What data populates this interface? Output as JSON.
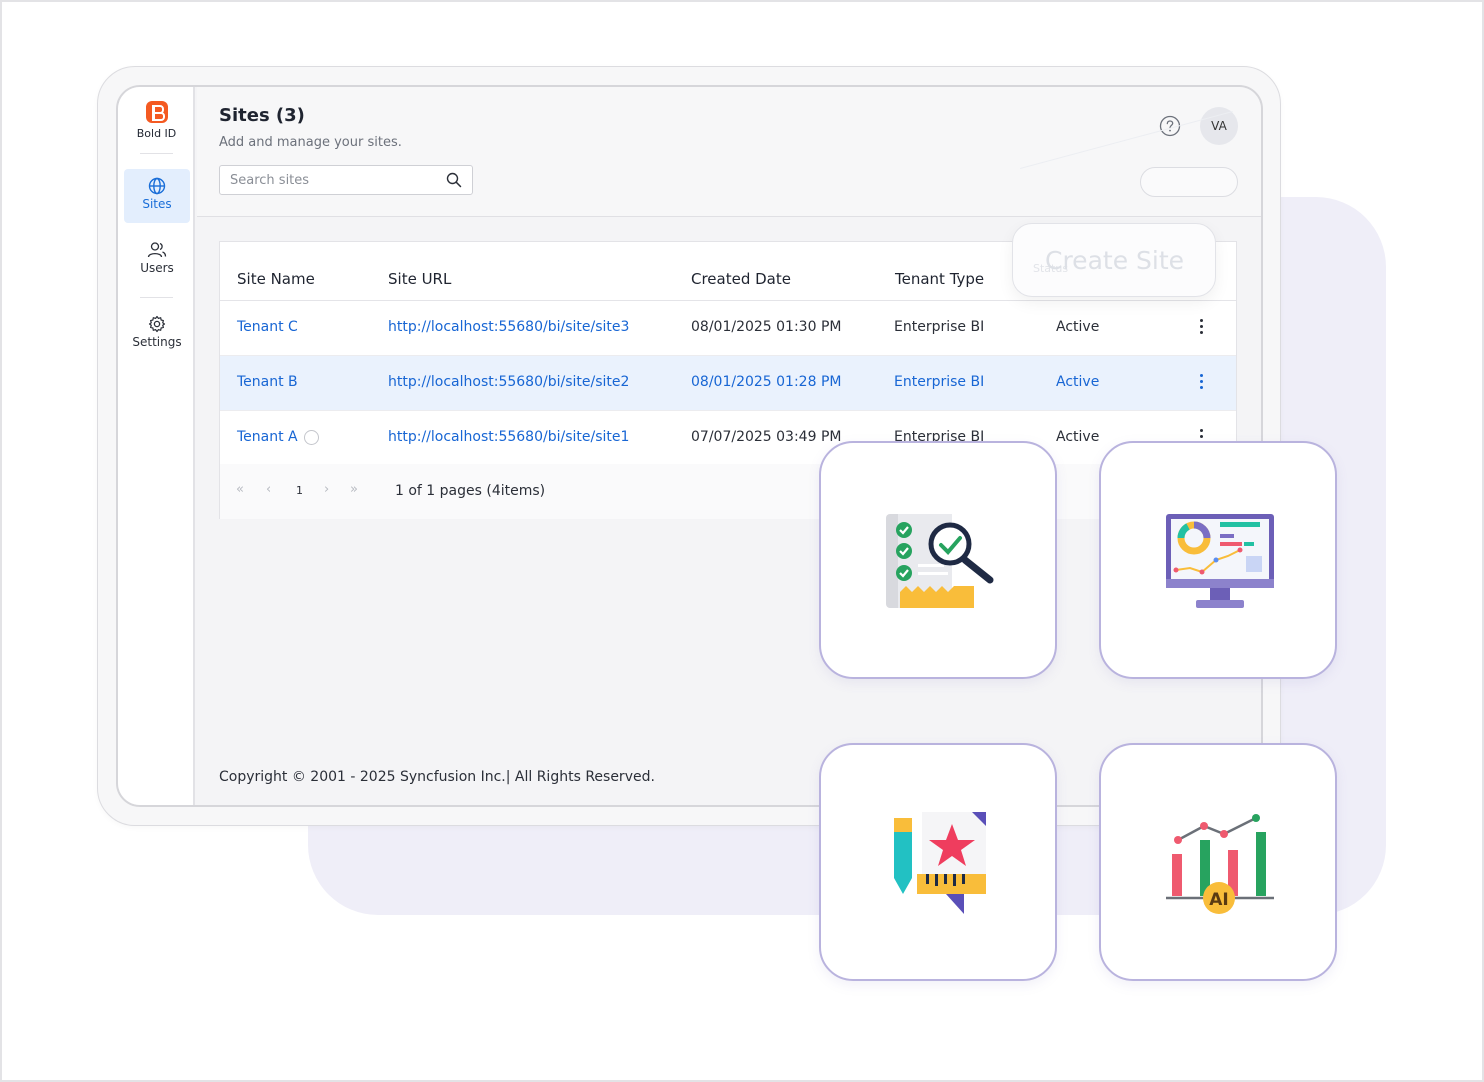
{
  "brand": {
    "name": "Bold ID"
  },
  "sidebar": {
    "items": [
      {
        "label": "Sites",
        "icon": "globe-icon",
        "active": true
      },
      {
        "label": "Users",
        "icon": "users-icon",
        "active": false
      },
      {
        "label": "Settings",
        "icon": "gear-icon",
        "active": false
      }
    ]
  },
  "header": {
    "title": "Sites (3)",
    "subtitle": "Add and manage your sites.",
    "search_placeholder": "Search sites",
    "avatar_initials": "VA"
  },
  "table": {
    "columns": [
      "Site Name",
      "Site URL",
      "Created Date",
      "Tenant Type",
      "Status"
    ],
    "rows": [
      {
        "name": "Tenant C",
        "url": "http://localhost:55680/bi/site/site3",
        "created": "08/01/2025 01:30 PM",
        "type": "Enterprise BI",
        "status": "Active",
        "highlighted": false
      },
      {
        "name": "Tenant B",
        "url": "http://localhost:55680/bi/site/site2",
        "created": "08/01/2025 01:28 PM",
        "type": "Enterprise BI",
        "status": "Active",
        "highlighted": true
      },
      {
        "name": "Tenant A",
        "url": "http://localhost:55680/bi/site/site1",
        "created": "07/07/2025 03:49 PM",
        "type": "Enterprise BI",
        "status": "Active",
        "highlighted": false
      }
    ]
  },
  "pager": {
    "first": "«",
    "prev": "‹",
    "current_page": "1",
    "next": "›",
    "last": "»",
    "info": "1 of 1 pages (4items)"
  },
  "footer": {
    "copyright": "Copyright © 2001 - 2025 Syncfusion Inc.| All Rights Reserved."
  },
  "create_site": {
    "label": "Create Site"
  },
  "tiles": [
    {
      "icon": "checklist-search-icon"
    },
    {
      "icon": "dashboard-monitor-icon"
    },
    {
      "icon": "design-star-icon"
    },
    {
      "icon": "ai-analytics-icon"
    }
  ],
  "colors": {
    "accent": "#1866d4",
    "brand": "#f45a22",
    "row_highlight": "#eaf2fd",
    "tile_border": "#b9b3de",
    "background_blob": "#efeef8"
  }
}
